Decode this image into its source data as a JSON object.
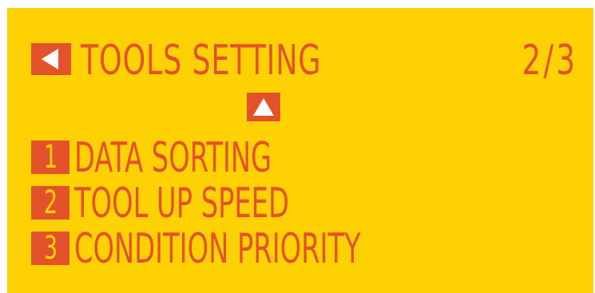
{
  "header": {
    "title": "TOOLS SETTING",
    "page_indicator": "2/3"
  },
  "menu": {
    "items": [
      {
        "number": "1",
        "label": "DATA SORTING"
      },
      {
        "number": "2",
        "label": "TOOL UP SPEED"
      },
      {
        "number": "3",
        "label": "CONDITION PRIORITY"
      }
    ]
  },
  "icons": {
    "back": "left-triangle-icon",
    "up": "up-triangle-icon"
  },
  "colors": {
    "background": "#fdd102",
    "foreground": "#e3522b"
  }
}
